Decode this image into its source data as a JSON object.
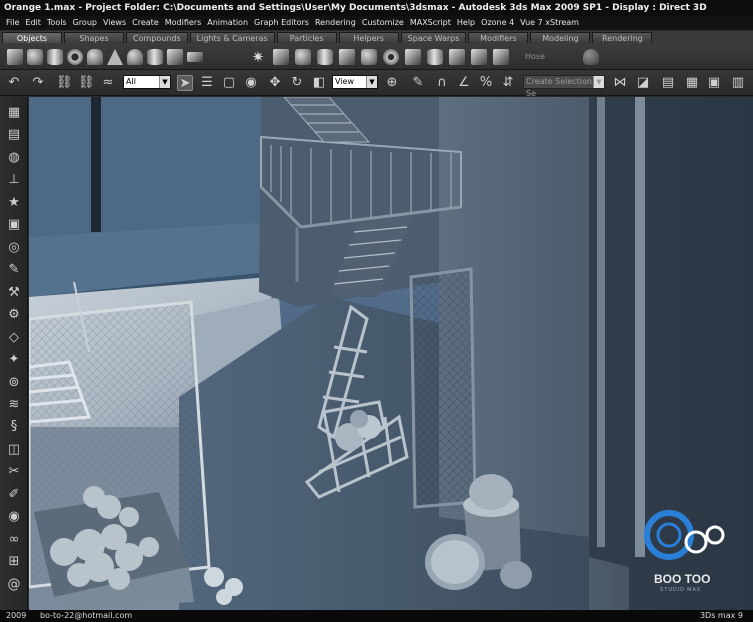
{
  "window": {
    "title": "Orange 1.max    - Project Folder: C:\\Documents and Settings\\User\\My Documents\\3dsmax    - Autodesk 3ds Max  2009 SP1         - Display : Direct 3D"
  },
  "menu": {
    "items": [
      "File",
      "Edit",
      "Tools",
      "Group",
      "Views",
      "Create",
      "Modifiers",
      "Animation",
      "Graph Editors",
      "Rendering",
      "Customize",
      "MAXScript",
      "Help",
      "Ozone 4",
      "Vue 7 xStream"
    ]
  },
  "tabs": {
    "items": [
      "Objects",
      "Shapes",
      "Compounds",
      "Lights & Cameras",
      "Particles",
      "Helpers",
      "Space Warps",
      "Modifiers",
      "Modeling",
      "Rendering"
    ],
    "active": "Objects"
  },
  "create_panel": {
    "hose_label": "Hose"
  },
  "main_toolbar": {
    "filter_value": "All",
    "coord_value": "View",
    "selection_set_placeholder": "Create Selection Se"
  },
  "watermark": {
    "brand": "BOO TOO",
    "sub": "STUDIO MAX",
    "colors": {
      "ring": "#2a7fd8",
      "text": "#e8e8e8"
    }
  },
  "status": {
    "year": "2009",
    "email": "bo-to-22@hotmail.com",
    "product": "3Ds max 9"
  }
}
